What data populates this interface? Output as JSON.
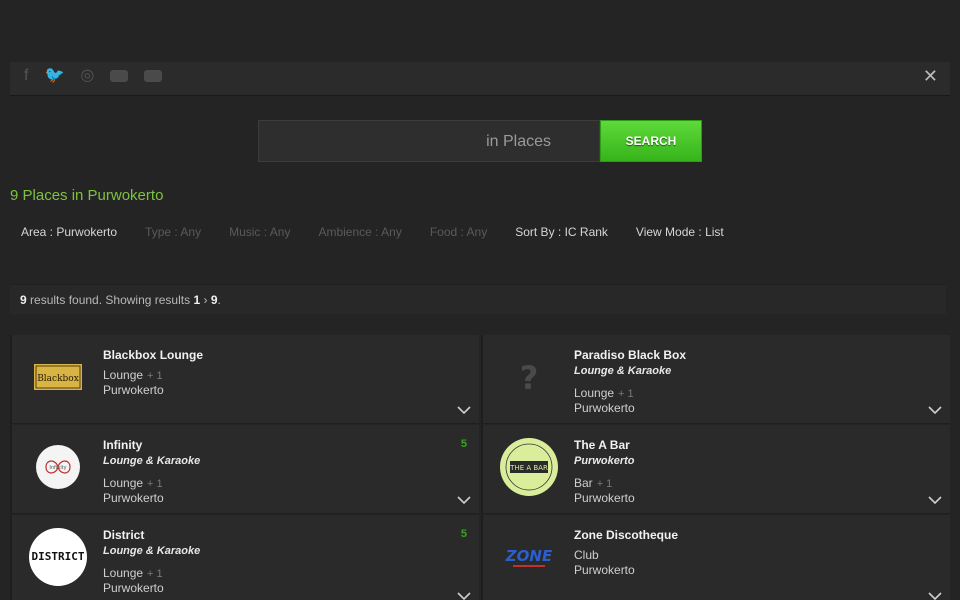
{
  "social": {
    "close": "✕"
  },
  "search": {
    "value": "",
    "suffix": "in Places",
    "button": "SEARCH"
  },
  "heading": "9 Places in Purwokerto",
  "filters": [
    {
      "label": "Area : Purwokerto",
      "active": true
    },
    {
      "label": "Type : Any",
      "active": false
    },
    {
      "label": "Music : Any",
      "active": false
    },
    {
      "label": "Ambience : Any",
      "active": false
    },
    {
      "label": "Food : Any",
      "active": false
    },
    {
      "label": "Sort By : IC Rank",
      "active": true
    },
    {
      "label": "View Mode : List",
      "active": true
    }
  ],
  "results": {
    "total": "9",
    "text1": " results found. Showing results ",
    "from": "1",
    "sep": " › ",
    "to": "9",
    "end": "."
  },
  "places": [
    {
      "name": "Blackbox Lounge",
      "tagline": "",
      "category": "Lounge",
      "extra": "+ 1",
      "location": "Purwokerto",
      "score": "",
      "logo_text": "Blackbox"
    },
    {
      "name": "Paradiso Black Box",
      "tagline": "Lounge & Karaoke",
      "category": "Lounge",
      "extra": "+ 1",
      "location": "Purwokerto",
      "score": "",
      "logo_text": "?"
    },
    {
      "name": "Infinity",
      "tagline": "Lounge & Karaoke",
      "category": "Lounge",
      "extra": "+ 1",
      "location": "Purwokerto",
      "score": "5",
      "logo_text": "Infinity"
    },
    {
      "name": "The A Bar",
      "tagline": "Purwokerto",
      "category": "Bar",
      "extra": "+ 1",
      "location": "Purwokerto",
      "score": "",
      "logo_text": "THE A BAR"
    },
    {
      "name": "District",
      "tagline": "Lounge & Karaoke",
      "category": "Lounge",
      "extra": "+ 1",
      "location": "Purwokerto",
      "score": "5",
      "logo_text": "DISTRICT"
    },
    {
      "name": "Zone Discotheque",
      "tagline": "",
      "category": "Club",
      "extra": "",
      "location": "Purwokerto",
      "score": "",
      "logo_text": "ZONE"
    }
  ],
  "colors": {
    "accent_green": "#7dc240",
    "button_green": "#4cc82a",
    "score_green": "#33a81a"
  }
}
